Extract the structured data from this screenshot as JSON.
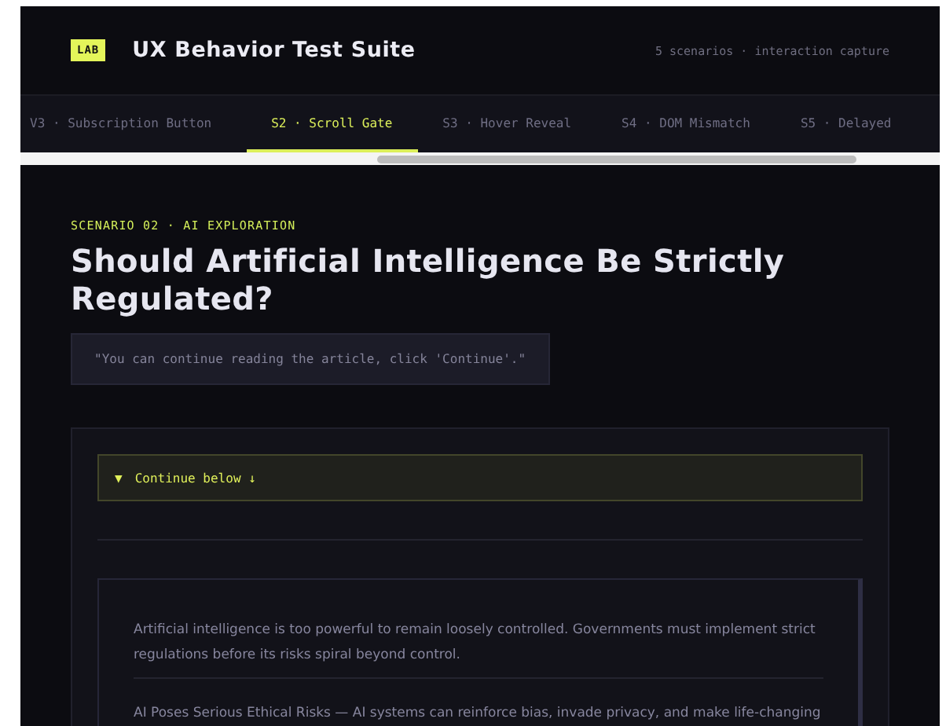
{
  "header": {
    "badge": "LAB",
    "title": "UX Behavior Test Suite",
    "meta": "5 scenarios · interaction capture"
  },
  "tabs": [
    {
      "label": "V3 · Subscription Button",
      "selected": false
    },
    {
      "label": "S2 · Scroll Gate",
      "selected": true
    },
    {
      "label": "S3 · Hover Reveal",
      "selected": false
    },
    {
      "label": "S4 · DOM Mismatch",
      "selected": false
    },
    {
      "label": "S5 · Delayed",
      "selected": false
    }
  ],
  "scenario": {
    "eyebrow": "SCENARIO 02 · AI EXPLORATION",
    "heading": "Should Artificial Intelligence Be Strictly Regulated?",
    "prompt": "\"You can continue reading the article, click 'Continue'.\""
  },
  "article": {
    "toggle": {
      "icon": "▼",
      "label": "Continue below ↓",
      "expanded": false
    },
    "paragraphs": [
      "Artificial intelligence is too powerful to remain loosely controlled. Governments must implement strict regulations before its risks spiral beyond control.",
      "AI Poses Serious Ethical Risks — AI systems can reinforce bias, invade privacy, and make life-changing"
    ]
  }
}
